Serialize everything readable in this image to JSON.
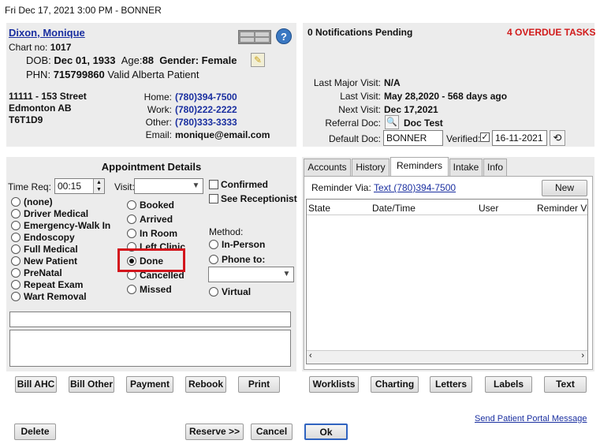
{
  "titlebar": {
    "text": "Fri Dec 17, 2021  3:00 PM - BONNER"
  },
  "patient": {
    "name": "Dixon, Monique",
    "chart_label": "Chart no:",
    "chart_no": "1017",
    "dob_label": "DOB:",
    "dob": "Dec 01, 1933",
    "age_label": "Age:",
    "age": "88",
    "gender_label": "Gender:",
    "gender": "Female",
    "phn_label": "PHN:",
    "phn": "715799860",
    "phn_status": "Valid Alberta Patient",
    "address1": "11111 - 153 Street",
    "address2": "Edmonton  AB",
    "postal": "T6T1D9",
    "home_label": "Home:",
    "home": "(780)394-7500",
    "work_label": "Work:",
    "work": "(780)222-2222",
    "other_label": "Other:",
    "other": "(780)333-3333",
    "email_label": "Email:",
    "email": "monique@email.com"
  },
  "notifications": {
    "pending": "0 Notifications Pending",
    "overdue": "4 OVERDUE TASKS",
    "last_major_label": "Last Major Visit:",
    "last_major": "N/A",
    "last_visit_label": "Last Visit:",
    "last_visit": "May 28,2020 - 568 days ago",
    "next_visit_label": "Next Visit:",
    "next_visit": "Dec 17,2021",
    "referral_label": "Referral Doc:",
    "referral": "Doc Test",
    "default_doc_label": "Default Doc:",
    "default_doc": "BONNER",
    "verified_label": "Verified:",
    "verified_date": "16-11-2021"
  },
  "appointment": {
    "header": "Appointment Details",
    "time_req_label": "Time Req:",
    "time_req": "00:15",
    "visit_label": "Visit:",
    "confirmed": "Confirmed",
    "see_receptionist": "See Receptionist",
    "types": [
      "(none)",
      "Driver Medical",
      "Emergency-Walk In",
      "Endoscopy",
      "Full Medical",
      "New Patient",
      "PreNatal",
      "Repeat Exam",
      "Wart Removal"
    ],
    "statuses": [
      "Booked",
      "Arrived",
      "In Room",
      "Left Clinic",
      "Done",
      "Cancelled",
      "Missed"
    ],
    "selected_status": "Done",
    "method_label": "Method:",
    "methods": [
      "In-Person",
      "Phone to:",
      "Virtual"
    ]
  },
  "tabs": {
    "items": [
      "Accounts",
      "History",
      "Reminders",
      "Intake",
      "Info"
    ],
    "active": "Reminders",
    "reminder_via_label": "Reminder Via:",
    "reminder_via": "Text (780)394-7500",
    "new_label": "New",
    "columns": [
      "State",
      "Date/Time",
      "User",
      "Reminder Vi"
    ]
  },
  "actions_left": [
    "Bill AHC",
    "Bill Other",
    "Payment",
    "Rebook",
    "Print"
  ],
  "actions_right": [
    "Worklists",
    "Charting",
    "Letters",
    "Labels",
    "Text"
  ],
  "portal_link": "Send Patient Portal Message",
  "footer": {
    "delete": "Delete",
    "reserve": "Reserve >>",
    "cancel": "Cancel",
    "ok": "Ok"
  },
  "colors": {
    "overdue": "#d11a1a",
    "link": "#1a2fa0",
    "highlight": "#d3141c",
    "panel": "#ececec"
  }
}
